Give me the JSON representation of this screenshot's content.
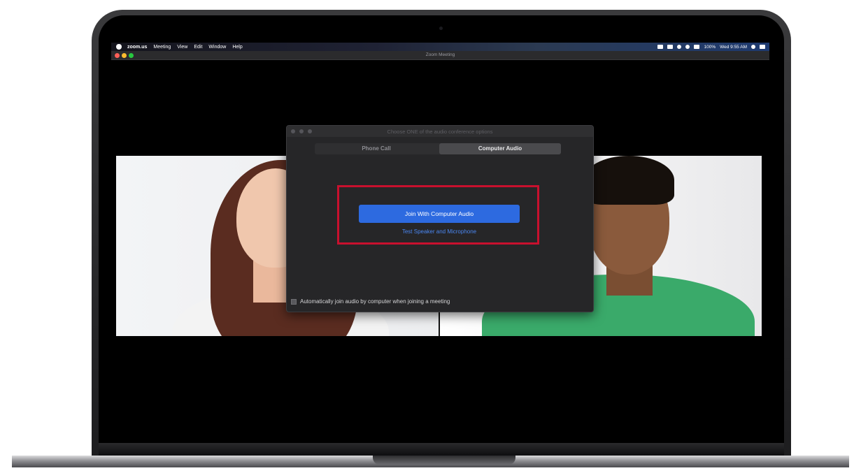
{
  "menubar": {
    "apple_icon": "apple-logo-icon",
    "items": [
      "zoom.us",
      "Meeting",
      "View",
      "Edit",
      "Window",
      "Help"
    ],
    "battery": "100%",
    "clock": "Wed 9:55 AM",
    "status_icons": [
      "zoom-icon",
      "cloud-icon",
      "spotlight-icon",
      "wifi-icon",
      "volume-icon",
      "search-icon",
      "list-icon"
    ]
  },
  "window": {
    "title": "Zoom Meeting"
  },
  "dialog": {
    "title": "Choose ONE of the audio conference options",
    "tabs": [
      {
        "label": "Phone Call",
        "selected": false
      },
      {
        "label": "Computer Audio",
        "selected": true
      }
    ],
    "join_button": "Join With Computer Audio",
    "test_link": "Test Speaker and Microphone",
    "auto_join_label": "Automatically join audio by computer when joining a meeting",
    "auto_join_checked": false
  },
  "colors": {
    "highlight": "#c8102e",
    "primary_button": "#2d6ae0",
    "link": "#4a86f0"
  }
}
